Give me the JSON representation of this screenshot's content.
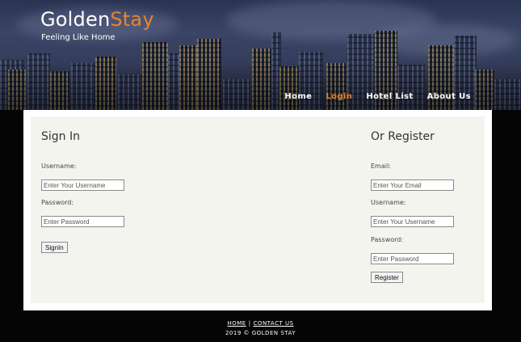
{
  "brand": {
    "name_part1": "Golden",
    "name_part2": "Stay",
    "tagline": "Feeling Like Home",
    "accent_color": "#e8822d"
  },
  "nav": {
    "items": [
      {
        "label": "Home",
        "active": false
      },
      {
        "label": "Login",
        "active": true
      },
      {
        "label": "Hotel List",
        "active": false
      },
      {
        "label": "About Us",
        "active": false
      }
    ]
  },
  "signin": {
    "title": "Sign In",
    "username_label": "Username:",
    "username_placeholder": "Enter Your Username",
    "password_label": "Password:",
    "password_placeholder": "Enter Password",
    "submit_label": "SignIn"
  },
  "register": {
    "title": "Or Register",
    "email_label": "Email:",
    "email_placeholder": "Enter Your Email",
    "username_label": "Username:",
    "username_placeholder": "Enter Your Username",
    "password_label": "Password:",
    "password_placeholder": "Enter Password",
    "submit_label": "Register"
  },
  "footer": {
    "home_link": "HOME",
    "separator": "|",
    "contact_link": "CONTACT US",
    "copyright": "2019 © GOLDEN STAY"
  }
}
